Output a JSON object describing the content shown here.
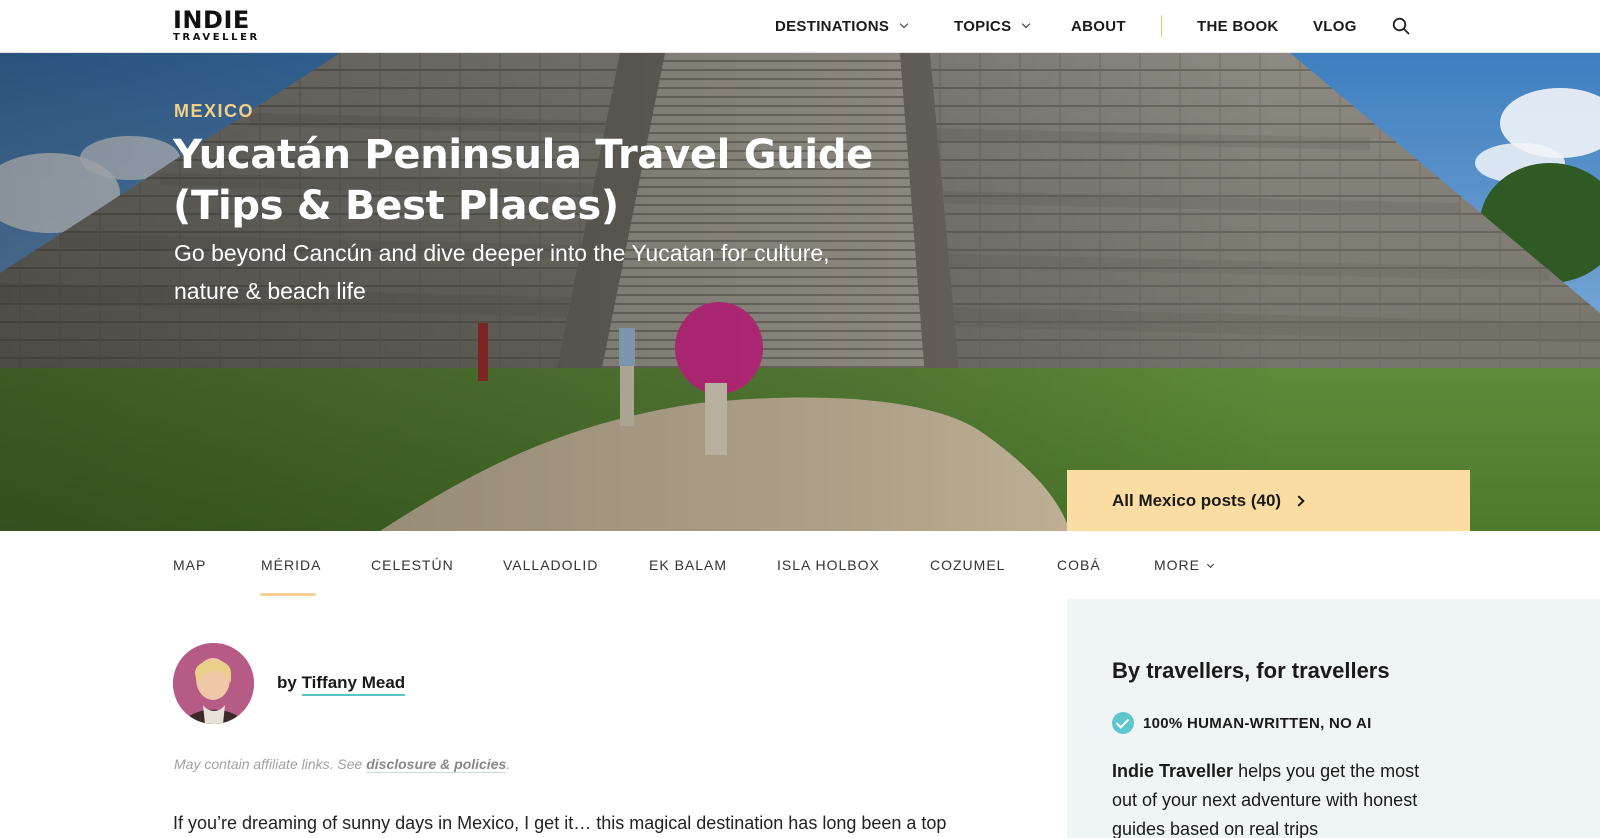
{
  "header": {
    "logo_line1": "INDIE",
    "logo_line2": "TRAVELLER",
    "nav": {
      "destinations": "DESTINATIONS",
      "topics": "TOPICS",
      "about": "ABOUT",
      "book": "THE BOOK",
      "vlog": "VLOG"
    }
  },
  "hero": {
    "kicker": "MEXICO",
    "title": "Yucatán Peninsula Travel Guide (Tips & Best Places)",
    "subtitle": "Go beyond Cancún and dive deeper into the Yucatan for culture, nature & beach life",
    "all_posts": "All Mexico posts (40)"
  },
  "subnav": {
    "items": [
      "MAP",
      "MÉRIDA",
      "CELESTÚN",
      "VALLADOLID",
      "EK BALAM",
      "ISLA HOLBOX",
      "COZUMEL",
      "COBÁ"
    ],
    "more": "MORE",
    "active": "MÉRIDA"
  },
  "article": {
    "by": "by",
    "author": "Tiffany Mead",
    "affiliate_text": "May contain affiliate links. See",
    "affiliate_link": "disclosure & policies",
    "affiliate_end": ".",
    "intro": "If you’re dreaming of sunny days in Mexico, I get it… this magical destination has long been a top"
  },
  "sidebar": {
    "title": "By travellers, for travellers",
    "badge": "100% HUMAN-WRITTEN, NO AI",
    "brand": "Indie Traveller",
    "text": " helps you get the most out of your next adventure with honest guides based on real trips"
  },
  "colors": {
    "accent": "#fbdda3",
    "kicker": "#f6cf85",
    "teal": "#5ec6cc",
    "sidebar_bg": "#eef5f4"
  }
}
